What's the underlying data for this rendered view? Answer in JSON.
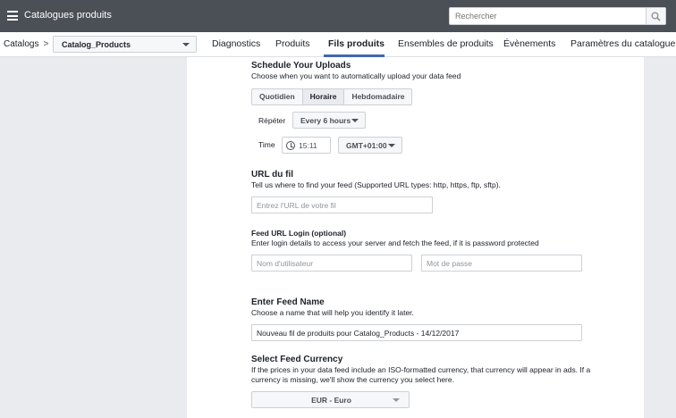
{
  "topbar": {
    "title": "Catalogues produits",
    "search_placeholder": "Rechercher"
  },
  "breadcrumb": {
    "label": "Catalogs",
    "chevron": ">"
  },
  "catalog_select": {
    "value": "Catalog_Products"
  },
  "tabs": [
    {
      "label": "Diagnostics"
    },
    {
      "label": "Produits"
    },
    {
      "label": "Fils produits",
      "active": true
    },
    {
      "label": "Ensembles de produits"
    },
    {
      "label": "Évènements"
    },
    {
      "label": "Paramètres du catalogue"
    }
  ],
  "schedule": {
    "title": "Schedule Your Uploads",
    "subtitle": "Choose when you want to automatically upload your data feed",
    "options": [
      "Quotidien",
      "Horaire",
      "Hebdomadaire"
    ],
    "selected": "Horaire",
    "repeat_label": "Répéter",
    "repeat_value": "Every 6 hours",
    "time_label": "Time",
    "time_value": "15:11",
    "timezone": "GMT+01:00"
  },
  "url": {
    "title": "URL du fil",
    "subtitle": "Tell us where to find your feed (Supported URL types: http, https, ftp, sftp).",
    "placeholder": "Entrez l'URL de votre fil"
  },
  "login": {
    "title": "Feed URL Login (optional)",
    "subtitle": "Enter login details to access your server and fetch the feed, if it is password protected",
    "username_placeholder": "Nom d'utilisateur",
    "password_placeholder": "Mot de passe"
  },
  "feed_name": {
    "title": "Enter Feed Name",
    "subtitle": "Choose a name that will help you identify it later.",
    "value": "Nouveau fil de produits pour Catalog_Products - 14/12/2017"
  },
  "currency": {
    "title": "Select Feed Currency",
    "subtitle_line1": "If the prices in your data feed include an ISO-formatted currency, that currency will appear in ads. If a",
    "subtitle_line2": "currency is missing, we'll show the currency you select here.",
    "value": "EUR - Euro"
  },
  "colors": {
    "topbar": "#4b4f56",
    "accent": "#4267b2",
    "background": "#e9ebee"
  }
}
